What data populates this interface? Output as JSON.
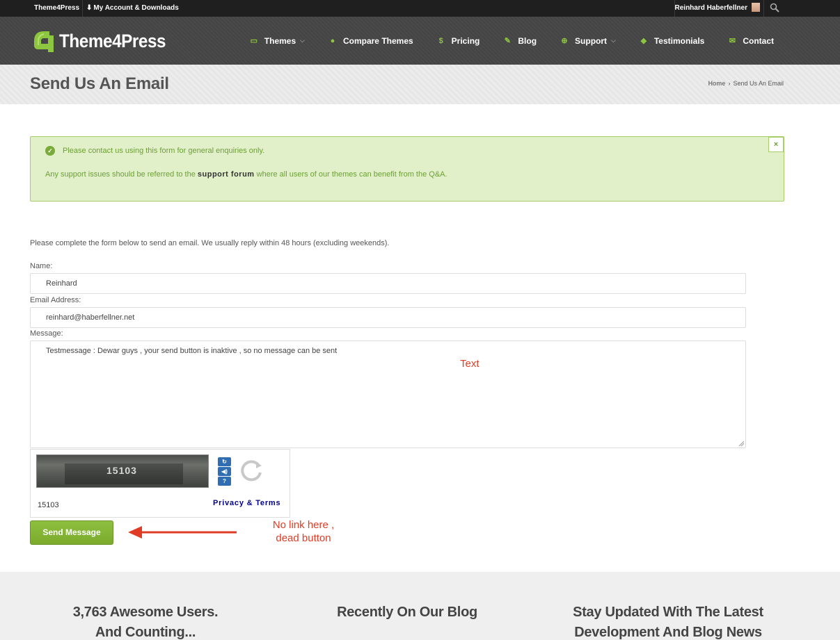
{
  "adminbar": {
    "site_name": "Theme4Press",
    "account_label": "My Account & Downloads",
    "user_name": "Reinhard Haberfellner"
  },
  "header": {
    "logo_text": "Theme4Press",
    "nav": [
      {
        "label": "Themes",
        "icon": "monitor-icon",
        "has_dropdown": true
      },
      {
        "label": "Compare Themes",
        "icon": "droplet-icon",
        "has_dropdown": false
      },
      {
        "label": "Pricing",
        "icon": "dollar-icon",
        "has_dropdown": false
      },
      {
        "label": "Blog",
        "icon": "pencil-icon",
        "has_dropdown": false
      },
      {
        "label": "Support",
        "icon": "lifebuoy-icon",
        "has_dropdown": true
      },
      {
        "label": "Testimonials",
        "icon": "speech-bubble-icon",
        "has_dropdown": false
      },
      {
        "label": "Contact",
        "icon": "envelope-icon",
        "has_dropdown": false
      }
    ],
    "accent_color": "#8dc63f"
  },
  "title_band": {
    "title": "Send Us An Email",
    "breadcrumb_home": "Home",
    "breadcrumb_current": "Send Us An Email"
  },
  "alert": {
    "line1": "Please contact us using this form for general enquiries only.",
    "line2_before": "Any support issues should be referred to the ",
    "line2_link": "support forum",
    "line2_after": " where all users of our themes can benefit from the Q&A.",
    "close_label": "×",
    "color": "#6ba033"
  },
  "form": {
    "intro": "Please complete the form below to send an email. We usually reply within 48 hours (excluding weekends).",
    "name_label": "Name:",
    "name_value": "Reinhard",
    "email_label": "Email Address:",
    "email_value": "reinhard@haberfellner.net",
    "message_label": "Message:",
    "message_value": "Testmessage : Dewar guys , your send button is inaktive , so no message can be sent",
    "captcha_image_text": "15103",
    "captcha_value": "15103",
    "captcha_privacy": "Privacy & Terms",
    "send_label": "Send Message"
  },
  "annotations": {
    "text_note": "Text",
    "button_note_line1": "No link here ,",
    "button_note_line2": "dead button",
    "color": "#e03b24"
  },
  "footer": {
    "col1_line1": "3,763 Awesome Users.",
    "col1_line2": "And Counting...",
    "col2_line1": "Recently On Our Blog",
    "col3_line1": "Stay Updated With The Latest",
    "col3_line2": "Development And Blog News"
  }
}
